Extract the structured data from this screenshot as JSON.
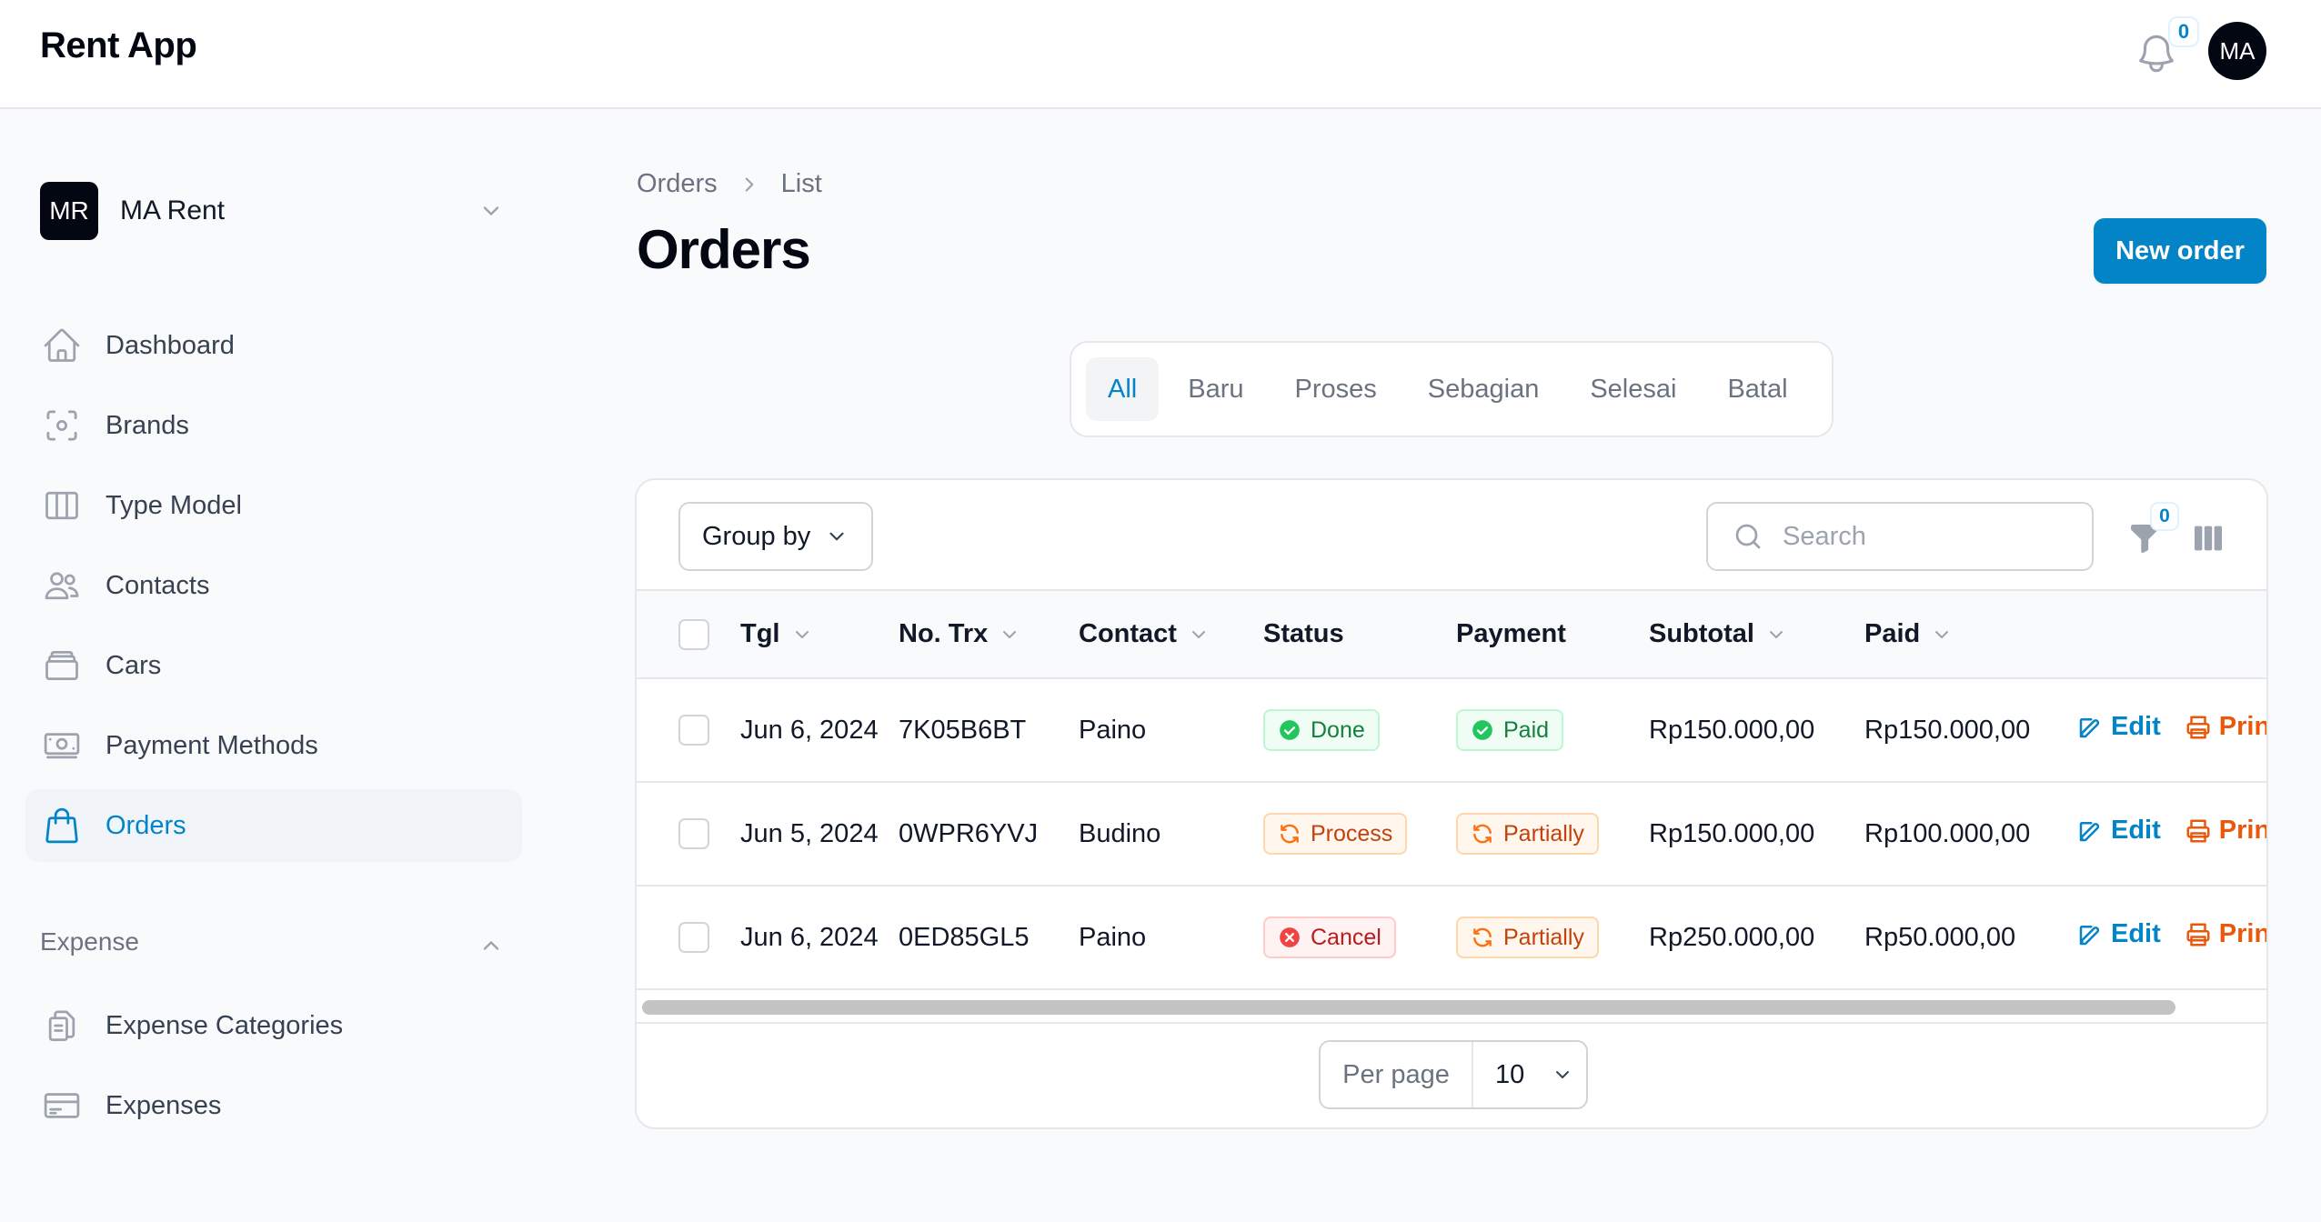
{
  "app": {
    "title": "Rent App"
  },
  "topbar": {
    "notification_count": "0",
    "user_initials": "MA"
  },
  "tenant": {
    "initials": "MR",
    "name": "MA Rent"
  },
  "sidebar": {
    "items": [
      {
        "label": "Dashboard",
        "icon": "home-icon"
      },
      {
        "label": "Brands",
        "icon": "brands-icon"
      },
      {
        "label": "Type Model",
        "icon": "columns-icon"
      },
      {
        "label": "Contacts",
        "icon": "users-icon"
      },
      {
        "label": "Cars",
        "icon": "stack-icon"
      },
      {
        "label": "Payment Methods",
        "icon": "banknote-icon"
      },
      {
        "label": "Orders",
        "icon": "shopping-bag-icon",
        "active": true
      }
    ],
    "group_label": "Expense",
    "group_items": [
      {
        "label": "Expense Categories",
        "icon": "clipboard-icon"
      },
      {
        "label": "Expenses",
        "icon": "credit-card-icon"
      }
    ]
  },
  "breadcrumb": {
    "parent": "Orders",
    "current": "List"
  },
  "page": {
    "title": "Orders",
    "new_button": "New order"
  },
  "tabs": [
    "All",
    "Baru",
    "Proses",
    "Sebagian",
    "Selesai",
    "Batal"
  ],
  "toolbar": {
    "group_by": "Group by",
    "search_placeholder": "Search",
    "filter_count": "0"
  },
  "table": {
    "columns": [
      "Tgl",
      "No. Trx",
      "Contact",
      "Status",
      "Payment",
      "Subtotal",
      "Paid"
    ],
    "rows": [
      {
        "tgl": "Jun 6, 2024",
        "trx": "7K05B6BT",
        "contact": "Paino",
        "status": "Done",
        "payment": "Paid",
        "subtotal": "Rp150.000,00",
        "paid": "Rp150.000,00"
      },
      {
        "tgl": "Jun 5, 2024",
        "trx": "0WPR6YVJ",
        "contact": "Budino",
        "status": "Process",
        "payment": "Partially",
        "subtotal": "Rp150.000,00",
        "paid": "Rp100.000,00"
      },
      {
        "tgl": "Jun 6, 2024",
        "trx": "0ED85GL5",
        "contact": "Paino",
        "status": "Cancel",
        "payment": "Partially",
        "subtotal": "Rp250.000,00",
        "paid": "Rp50.000,00"
      }
    ],
    "actions": {
      "edit": "Edit",
      "print": "Print"
    }
  },
  "pagination": {
    "per_page_label": "Per page",
    "per_page_value": "10"
  },
  "colors": {
    "accent": "#0284c7",
    "success": "#15803d",
    "warning": "#c2410c",
    "danger": "#b91c1c"
  }
}
